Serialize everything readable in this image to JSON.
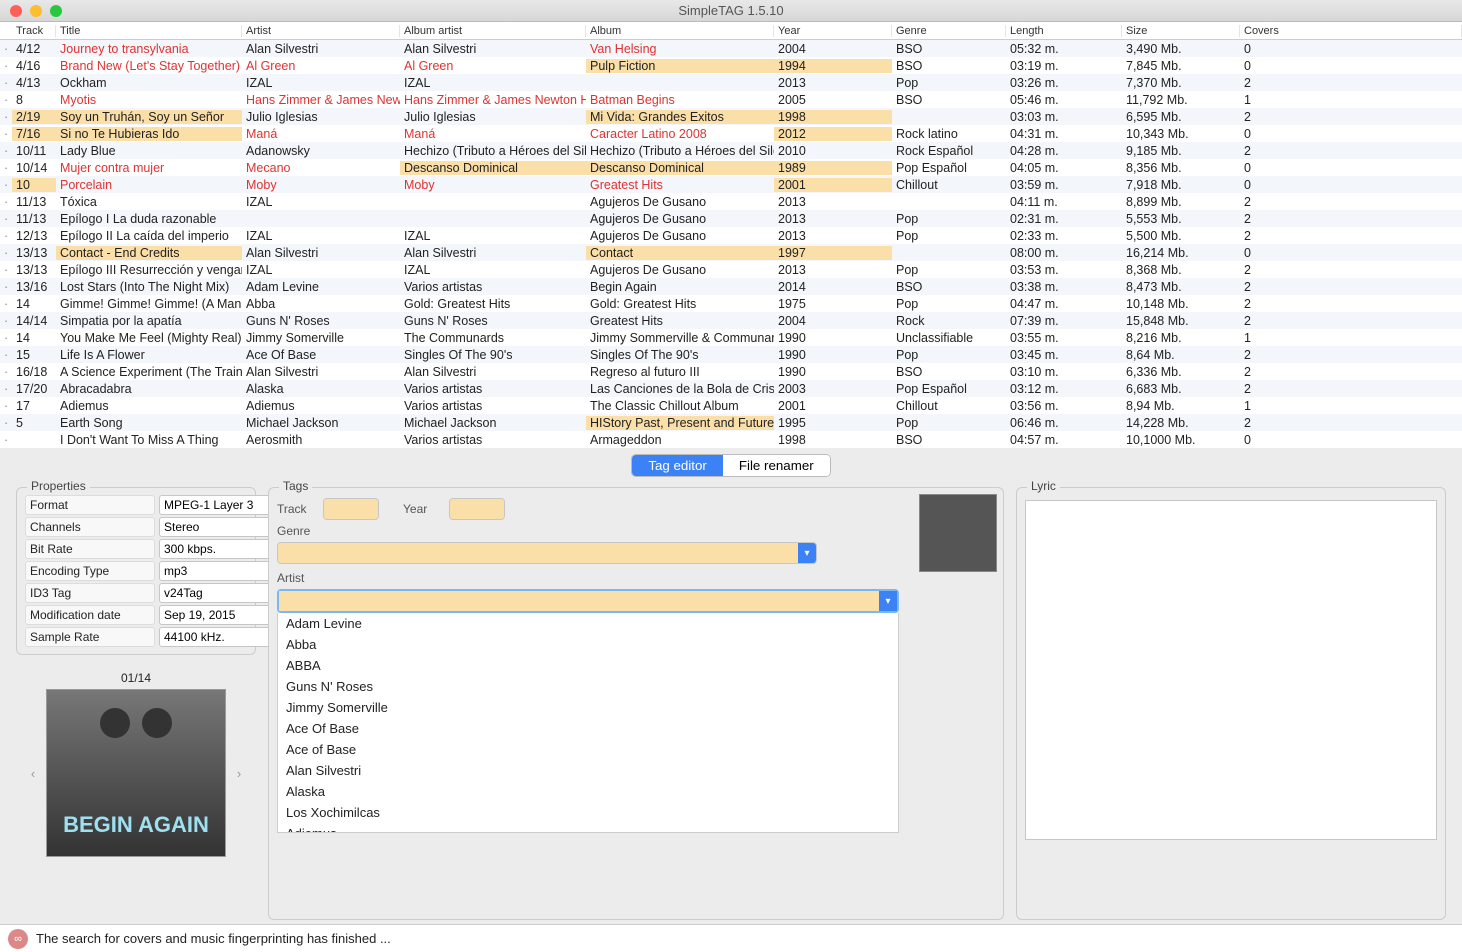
{
  "window_title": "SimpleTAG 1.5.10",
  "columns": {
    "track": "Track",
    "title": "Title",
    "artist": "Artist",
    "album_artist": "Album artist",
    "album": "Album",
    "year": "Year",
    "genre": "Genre",
    "length": "Length",
    "size": "Size",
    "covers": "Covers"
  },
  "rows": [
    {
      "trk": "4/12",
      "title": "Journey to transylvania",
      "artist": "Alan Silvestri",
      "album_artist": "Alan Silvestri",
      "album": "Van Helsing",
      "year": "2004",
      "genre": "BSO",
      "len": "05:32 m.",
      "size": "3,490 Mb.",
      "cov": "0",
      "hl": [
        "title",
        "album"
      ],
      "hy": []
    },
    {
      "trk": "4/16",
      "title": "Brand New (Let's Stay Together)",
      "artist": "Al Green",
      "album_artist": "Al Green",
      "album": "Pulp Fiction",
      "year": "1994",
      "genre": "BSO",
      "len": "03:19 m.",
      "size": "7,845 Mb.",
      "cov": "0",
      "hl": [
        "title",
        "artist",
        "album_artist"
      ],
      "hy": [
        "album",
        "year"
      ]
    },
    {
      "trk": "4/13",
      "title": "Ockham",
      "artist": "IZAL",
      "album_artist": "IZAL",
      "album": "",
      "year": "2013",
      "genre": "Pop",
      "len": "03:26 m.",
      "size": "7,370 Mb.",
      "cov": "2",
      "hl": [],
      "hy": []
    },
    {
      "trk": "8",
      "title": "Myotis",
      "artist": "Hans Zimmer & James Newton Howard",
      "album_artist": "Hans Zimmer & James Newton Howard",
      "album": "Batman Begins",
      "year": "2005",
      "genre": "BSO",
      "len": "05:46 m.",
      "size": "11,792 Mb.",
      "cov": "1",
      "hl": [
        "title",
        "artist",
        "album_artist",
        "album"
      ],
      "hy": []
    },
    {
      "trk": "2/19",
      "title": "Soy un Truhán, Soy un Señor",
      "artist": "Julio Iglesias",
      "album_artist": "Julio Iglesias",
      "album": "Mi Vida: Grandes Exitos",
      "year": "1998",
      "genre": "",
      "len": "03:03 m.",
      "size": "6,595 Mb.",
      "cov": "2",
      "hl": [],
      "hy": [
        "trk",
        "title",
        "album",
        "year"
      ]
    },
    {
      "trk": "7/16",
      "title": "Si no Te Hubieras Ido",
      "artist": "Maná",
      "album_artist": "Maná",
      "album": "Caracter Latino 2008",
      "year": "2012",
      "genre": "Rock latino",
      "len": "04:31 m.",
      "size": "10,343 Mb.",
      "cov": "0",
      "hl": [
        "artist",
        "album_artist",
        "album"
      ],
      "hy": [
        "trk",
        "title",
        "year"
      ]
    },
    {
      "trk": "10/11",
      "title": "Lady Blue",
      "artist": "Adanowsky",
      "album_artist": "Hechizo (Tributo a Héroes del Silencio)",
      "album": "Hechizo (Tributo a Héroes del Silencio)",
      "year": "2010",
      "genre": "Rock Español",
      "len": "04:28 m.",
      "size": "9,185 Mb.",
      "cov": "2",
      "hl": [],
      "hy": []
    },
    {
      "trk": "10/14",
      "title": "Mujer contra mujer",
      "artist": "Mecano",
      "album_artist": "Descanso Dominical",
      "album": "Descanso Dominical",
      "year": "1989",
      "genre": "Pop Español",
      "len": "04:05 m.",
      "size": "8,356 Mb.",
      "cov": "0",
      "hl": [
        "title",
        "artist"
      ],
      "hy": [
        "album_artist",
        "album",
        "year"
      ]
    },
    {
      "trk": "10",
      "title": "Porcelain",
      "artist": "Moby",
      "album_artist": "Moby",
      "album": "Greatest Hits",
      "year": "2001",
      "genre": "Chillout",
      "len": "03:59 m.",
      "size": "7,918 Mb.",
      "cov": "0",
      "hl": [
        "title",
        "artist",
        "album_artist",
        "album"
      ],
      "hy": [
        "trk",
        "year"
      ]
    },
    {
      "trk": "11/13",
      "title": "Tóxica",
      "artist": "IZAL",
      "album_artist": "",
      "album": "Agujeros De Gusano",
      "year": "2013",
      "genre": "",
      "len": "04:11 m.",
      "size": "8,899 Mb.",
      "cov": "2",
      "hl": [],
      "hy": []
    },
    {
      "trk": "11/13",
      "title": "Epílogo I La duda razonable",
      "artist": "",
      "album_artist": "",
      "album": "Agujeros De Gusano",
      "year": "2013",
      "genre": "Pop",
      "len": "02:31 m.",
      "size": "5,553 Mb.",
      "cov": "2",
      "hl": [],
      "hy": []
    },
    {
      "trk": "12/13",
      "title": "Epílogo II La caída del imperio",
      "artist": "IZAL",
      "album_artist": "IZAL",
      "album": "Agujeros De Gusano",
      "year": "2013",
      "genre": "Pop",
      "len": "02:33 m.",
      "size": "5,500 Mb.",
      "cov": "2",
      "hl": [],
      "hy": []
    },
    {
      "trk": "13/13",
      "title": "Contact - End Credits",
      "artist": "Alan Silvestri",
      "album_artist": "Alan Silvestri",
      "album": "Contact",
      "year": "1997",
      "genre": "",
      "len": "08:00 m.",
      "size": "16,214 Mb.",
      "cov": "0",
      "hl": [],
      "hy": [
        "title",
        "album",
        "year"
      ]
    },
    {
      "trk": "13/13",
      "title": "Epílogo III Resurrección y venganza",
      "artist": "IZAL",
      "album_artist": "IZAL",
      "album": "Agujeros De Gusano",
      "year": "2013",
      "genre": "Pop",
      "len": "03:53 m.",
      "size": "8,368 Mb.",
      "cov": "2",
      "hl": [],
      "hy": []
    },
    {
      "trk": "13/16",
      "title": "Lost Stars (Into The Night Mix)",
      "artist": "Adam Levine",
      "album_artist": "Varios artistas",
      "album": "Begin Again",
      "year": "2014",
      "genre": "BSO",
      "len": "03:38 m.",
      "size": "8,473 Mb.",
      "cov": "2",
      "hl": [],
      "hy": []
    },
    {
      "trk": "14",
      "title": "Gimme! Gimme! Gimme! (A Man After Midnight)",
      "artist": "Abba",
      "album_artist": "Gold: Greatest Hits",
      "album": "Gold: Greatest Hits",
      "year": "1975",
      "genre": "Pop",
      "len": "04:47 m.",
      "size": "10,148 Mb.",
      "cov": "2",
      "hl": [],
      "hy": []
    },
    {
      "trk": "14/14",
      "title": "Simpatia por la apatía",
      "artist": "Guns N' Roses",
      "album_artist": "Guns N' Roses",
      "album": "Greatest Hits",
      "year": "2004",
      "genre": "Rock",
      "len": "07:39 m.",
      "size": "15,848 Mb.",
      "cov": "2",
      "hl": [],
      "hy": []
    },
    {
      "trk": "14",
      "title": "You Make Me Feel (Mighty Real)",
      "artist": "Jimmy Somerville",
      "album_artist": "The Communards",
      "album": "Jimmy Sommerville & Communards",
      "year": "1990",
      "genre": "Unclassifiable",
      "len": "03:55 m.",
      "size": "8,216 Mb.",
      "cov": "1",
      "hl": [],
      "hy": []
    },
    {
      "trk": "15",
      "title": "Life Is A Flower",
      "artist": "Ace Of Base",
      "album_artist": "Singles Of The 90's",
      "album": "Singles Of The 90's",
      "year": "1990",
      "genre": "Pop",
      "len": "03:45 m.",
      "size": "8,64 Mb.",
      "cov": "2",
      "hl": [],
      "hy": []
    },
    {
      "trk": "16/18",
      "title": "A Science Experiment (The Train)",
      "artist": "Alan Silvestri",
      "album_artist": "Alan Silvestri",
      "album": "Regreso al futuro III",
      "year": "1990",
      "genre": "BSO",
      "len": "03:10 m.",
      "size": "6,336 Mb.",
      "cov": "2",
      "hl": [],
      "hy": []
    },
    {
      "trk": "17/20",
      "title": "Abracadabra",
      "artist": "Alaska",
      "album_artist": "Varios artistas",
      "album": "Las Canciones de la Bola de Cristal",
      "year": "2003",
      "genre": "Pop Español",
      "len": "03:12 m.",
      "size": "6,683 Mb.",
      "cov": "2",
      "hl": [],
      "hy": []
    },
    {
      "trk": "17",
      "title": "Adiemus",
      "artist": "Adiemus",
      "album_artist": "Varios artistas",
      "album": "The Classic Chillout Album",
      "year": "2001",
      "genre": "Chillout",
      "len": "03:56 m.",
      "size": "8,94 Mb.",
      "cov": "1",
      "hl": [],
      "hy": []
    },
    {
      "trk": "5",
      "title": "Earth Song",
      "artist": "Michael Jackson",
      "album_artist": "Michael Jackson",
      "album": "HIStory Past, Present and Future",
      "year": "1995",
      "genre": "Pop",
      "len": "06:46 m.",
      "size": "14,228 Mb.",
      "cov": "2",
      "hl": [],
      "hy": [
        "album"
      ]
    },
    {
      "trk": "",
      "title": "I Don't Want To Miss A Thing",
      "artist": "Aerosmith",
      "album_artist": "Varios artistas",
      "album": "Armageddon",
      "year": "1998",
      "genre": "BSO",
      "len": "04:57 m.",
      "size": "10,1000 Mb.",
      "cov": "0",
      "hl": [],
      "hy": []
    }
  ],
  "tabs": {
    "editor": "Tag editor",
    "renamer": "File renamer"
  },
  "props_title": "Properties",
  "props": [
    {
      "k": "Format",
      "v": "MPEG-1 Layer 3"
    },
    {
      "k": "Channels",
      "v": "Stereo"
    },
    {
      "k": "Bit Rate",
      "v": "300 kbps."
    },
    {
      "k": "Encoding Type",
      "v": "mp3"
    },
    {
      "k": "ID3 Tag",
      "v": "v24Tag"
    },
    {
      "k": "Modification date",
      "v": "Sep 19, 2015"
    },
    {
      "k": "Sample Rate",
      "v": "44100 kHz."
    }
  ],
  "cover_counter": "01/14",
  "cover_text": "BEGIN AGAIN",
  "tags_title": "Tags",
  "tags_labels": {
    "track": "Track",
    "year": "Year",
    "genre": "Genre",
    "artist": "Artist"
  },
  "artist_options": [
    "Adam Levine",
    "Abba",
    "ABBA",
    "Guns N' Roses",
    "Jimmy Somerville",
    "Ace Of Base",
    "Ace of Base",
    "Alan Silvestri",
    "Alaska",
    "Los Xochimilcas",
    "Adiemus"
  ],
  "lyric_title": "Lyric",
  "status_text": "The search for covers and music fingerprinting has finished ..."
}
